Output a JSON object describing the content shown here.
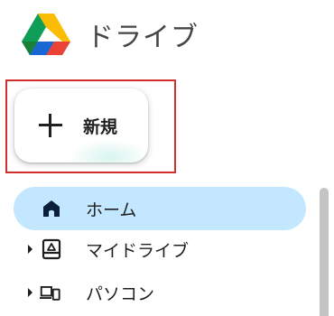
{
  "app": {
    "title": "ドライブ"
  },
  "new_button": {
    "label": "新規"
  },
  "nav": {
    "items": [
      {
        "label": "ホーム",
        "icon": "home-icon",
        "active": true,
        "expandable": false
      },
      {
        "label": "マイドライブ",
        "icon": "my-drive-icon",
        "active": false,
        "expandable": true
      },
      {
        "label": "パソコン",
        "icon": "computers-icon",
        "active": false,
        "expandable": true
      }
    ]
  },
  "colors": {
    "active_bg": "#c2e7ff",
    "highlight_border": "#d32f2f",
    "text": "#1f1f1f",
    "title_text": "#444746"
  }
}
